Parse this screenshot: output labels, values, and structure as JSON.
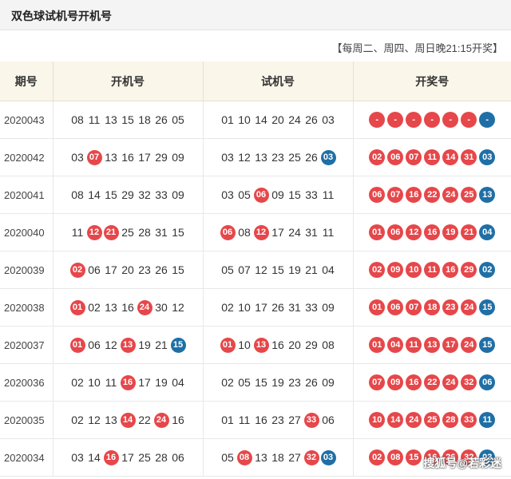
{
  "title": "双色球试机号开机号",
  "schedule_note": "【每周二、周四、周日晚21:15开奖】",
  "columns": [
    "期号",
    "开机号",
    "试机号",
    "开奖号"
  ],
  "colors": {
    "red_ball": "#e6474a",
    "blue_ball": "#1f6fa6",
    "header_bg": "#faf6ea"
  },
  "rows": [
    {
      "period": "2020043",
      "open": [
        [
          "08",
          ""
        ],
        [
          "11",
          ""
        ],
        [
          "13",
          ""
        ],
        [
          "15",
          ""
        ],
        [
          "18",
          ""
        ],
        [
          "26",
          ""
        ],
        [
          "05",
          ""
        ]
      ],
      "trial": [
        [
          "01",
          ""
        ],
        [
          "10",
          ""
        ],
        [
          "14",
          ""
        ],
        [
          "20",
          ""
        ],
        [
          "24",
          ""
        ],
        [
          "26",
          ""
        ],
        [
          "03",
          ""
        ]
      ],
      "award": [
        [
          "-",
          "red"
        ],
        [
          "-",
          "red"
        ],
        [
          "-",
          "red"
        ],
        [
          "-",
          "red"
        ],
        [
          "-",
          "red"
        ],
        [
          "-",
          "red"
        ],
        [
          "-",
          "blue"
        ]
      ]
    },
    {
      "period": "2020042",
      "open": [
        [
          "03",
          ""
        ],
        [
          "07",
          "red"
        ],
        [
          "13",
          ""
        ],
        [
          "16",
          ""
        ],
        [
          "17",
          ""
        ],
        [
          "29",
          ""
        ],
        [
          "09",
          ""
        ]
      ],
      "trial": [
        [
          "03",
          ""
        ],
        [
          "12",
          ""
        ],
        [
          "13",
          ""
        ],
        [
          "23",
          ""
        ],
        [
          "25",
          ""
        ],
        [
          "26",
          ""
        ],
        [
          "03",
          "blue"
        ]
      ],
      "award": [
        [
          "02",
          "red"
        ],
        [
          "06",
          "red"
        ],
        [
          "07",
          "red"
        ],
        [
          "11",
          "red"
        ],
        [
          "14",
          "red"
        ],
        [
          "31",
          "red"
        ],
        [
          "03",
          "blue"
        ]
      ]
    },
    {
      "period": "2020041",
      "open": [
        [
          "08",
          ""
        ],
        [
          "14",
          ""
        ],
        [
          "15",
          ""
        ],
        [
          "29",
          ""
        ],
        [
          "32",
          ""
        ],
        [
          "33",
          ""
        ],
        [
          "09",
          ""
        ]
      ],
      "trial": [
        [
          "03",
          ""
        ],
        [
          "05",
          ""
        ],
        [
          "06",
          "red"
        ],
        [
          "09",
          ""
        ],
        [
          "15",
          ""
        ],
        [
          "33",
          ""
        ],
        [
          "11",
          ""
        ]
      ],
      "award": [
        [
          "06",
          "red"
        ],
        [
          "07",
          "red"
        ],
        [
          "16",
          "red"
        ],
        [
          "22",
          "red"
        ],
        [
          "24",
          "red"
        ],
        [
          "25",
          "red"
        ],
        [
          "13",
          "blue"
        ]
      ]
    },
    {
      "period": "2020040",
      "open": [
        [
          "11",
          ""
        ],
        [
          "12",
          "red"
        ],
        [
          "21",
          "red"
        ],
        [
          "25",
          ""
        ],
        [
          "28",
          ""
        ],
        [
          "31",
          ""
        ],
        [
          "15",
          ""
        ]
      ],
      "trial": [
        [
          "06",
          "red"
        ],
        [
          "08",
          ""
        ],
        [
          "12",
          "red"
        ],
        [
          "17",
          ""
        ],
        [
          "24",
          ""
        ],
        [
          "31",
          ""
        ],
        [
          "11",
          ""
        ]
      ],
      "award": [
        [
          "01",
          "red"
        ],
        [
          "06",
          "red"
        ],
        [
          "12",
          "red"
        ],
        [
          "16",
          "red"
        ],
        [
          "19",
          "red"
        ],
        [
          "21",
          "red"
        ],
        [
          "04",
          "blue"
        ]
      ]
    },
    {
      "period": "2020039",
      "open": [
        [
          "02",
          "red"
        ],
        [
          "06",
          ""
        ],
        [
          "17",
          ""
        ],
        [
          "20",
          ""
        ],
        [
          "23",
          ""
        ],
        [
          "26",
          ""
        ],
        [
          "15",
          ""
        ]
      ],
      "trial": [
        [
          "05",
          ""
        ],
        [
          "07",
          ""
        ],
        [
          "12",
          ""
        ],
        [
          "15",
          ""
        ],
        [
          "19",
          ""
        ],
        [
          "21",
          ""
        ],
        [
          "04",
          ""
        ]
      ],
      "award": [
        [
          "02",
          "red"
        ],
        [
          "09",
          "red"
        ],
        [
          "10",
          "red"
        ],
        [
          "11",
          "red"
        ],
        [
          "16",
          "red"
        ],
        [
          "29",
          "red"
        ],
        [
          "02",
          "blue"
        ]
      ]
    },
    {
      "period": "2020038",
      "open": [
        [
          "01",
          "red"
        ],
        [
          "02",
          ""
        ],
        [
          "13",
          ""
        ],
        [
          "16",
          ""
        ],
        [
          "24",
          "red"
        ],
        [
          "30",
          ""
        ],
        [
          "12",
          ""
        ]
      ],
      "trial": [
        [
          "02",
          ""
        ],
        [
          "10",
          ""
        ],
        [
          "17",
          ""
        ],
        [
          "26",
          ""
        ],
        [
          "31",
          ""
        ],
        [
          "33",
          ""
        ],
        [
          "09",
          ""
        ]
      ],
      "award": [
        [
          "01",
          "red"
        ],
        [
          "06",
          "red"
        ],
        [
          "07",
          "red"
        ],
        [
          "18",
          "red"
        ],
        [
          "23",
          "red"
        ],
        [
          "24",
          "red"
        ],
        [
          "15",
          "blue"
        ]
      ]
    },
    {
      "period": "2020037",
      "open": [
        [
          "01",
          "red"
        ],
        [
          "06",
          ""
        ],
        [
          "12",
          ""
        ],
        [
          "13",
          "red"
        ],
        [
          "19",
          ""
        ],
        [
          "21",
          ""
        ],
        [
          "15",
          "blue"
        ]
      ],
      "trial": [
        [
          "01",
          "red"
        ],
        [
          "10",
          ""
        ],
        [
          "13",
          "red"
        ],
        [
          "16",
          ""
        ],
        [
          "20",
          ""
        ],
        [
          "29",
          ""
        ],
        [
          "08",
          ""
        ]
      ],
      "award": [
        [
          "01",
          "red"
        ],
        [
          "04",
          "red"
        ],
        [
          "11",
          "red"
        ],
        [
          "13",
          "red"
        ],
        [
          "17",
          "red"
        ],
        [
          "24",
          "red"
        ],
        [
          "15",
          "blue"
        ]
      ]
    },
    {
      "period": "2020036",
      "open": [
        [
          "02",
          ""
        ],
        [
          "10",
          ""
        ],
        [
          "11",
          ""
        ],
        [
          "16",
          "red"
        ],
        [
          "17",
          ""
        ],
        [
          "19",
          ""
        ],
        [
          "04",
          ""
        ]
      ],
      "trial": [
        [
          "02",
          ""
        ],
        [
          "05",
          ""
        ],
        [
          "15",
          ""
        ],
        [
          "19",
          ""
        ],
        [
          "23",
          ""
        ],
        [
          "26",
          ""
        ],
        [
          "09",
          ""
        ]
      ],
      "award": [
        [
          "07",
          "red"
        ],
        [
          "09",
          "red"
        ],
        [
          "16",
          "red"
        ],
        [
          "22",
          "red"
        ],
        [
          "24",
          "red"
        ],
        [
          "32",
          "red"
        ],
        [
          "06",
          "blue"
        ]
      ]
    },
    {
      "period": "2020035",
      "open": [
        [
          "02",
          ""
        ],
        [
          "12",
          ""
        ],
        [
          "13",
          ""
        ],
        [
          "14",
          "red"
        ],
        [
          "22",
          ""
        ],
        [
          "24",
          "red"
        ],
        [
          "16",
          ""
        ]
      ],
      "trial": [
        [
          "01",
          ""
        ],
        [
          "11",
          ""
        ],
        [
          "16",
          ""
        ],
        [
          "23",
          ""
        ],
        [
          "27",
          ""
        ],
        [
          "33",
          "red"
        ],
        [
          "06",
          ""
        ]
      ],
      "award": [
        [
          "10",
          "red"
        ],
        [
          "14",
          "red"
        ],
        [
          "24",
          "red"
        ],
        [
          "25",
          "red"
        ],
        [
          "28",
          "red"
        ],
        [
          "33",
          "red"
        ],
        [
          "11",
          "blue"
        ]
      ]
    },
    {
      "period": "2020034",
      "open": [
        [
          "03",
          ""
        ],
        [
          "14",
          ""
        ],
        [
          "16",
          "red"
        ],
        [
          "17",
          ""
        ],
        [
          "25",
          ""
        ],
        [
          "28",
          ""
        ],
        [
          "06",
          ""
        ]
      ],
      "trial": [
        [
          "05",
          ""
        ],
        [
          "08",
          "red"
        ],
        [
          "13",
          ""
        ],
        [
          "18",
          ""
        ],
        [
          "27",
          ""
        ],
        [
          "32",
          "red"
        ],
        [
          "03",
          "blue"
        ]
      ],
      "award": [
        [
          "02",
          "red"
        ],
        [
          "08",
          "red"
        ],
        [
          "15",
          "red"
        ],
        [
          "16",
          "red"
        ],
        [
          "26",
          "red"
        ],
        [
          "32",
          "red"
        ],
        [
          "03",
          "blue"
        ]
      ]
    }
  ],
  "watermark": "搜狐号@若彩迷"
}
